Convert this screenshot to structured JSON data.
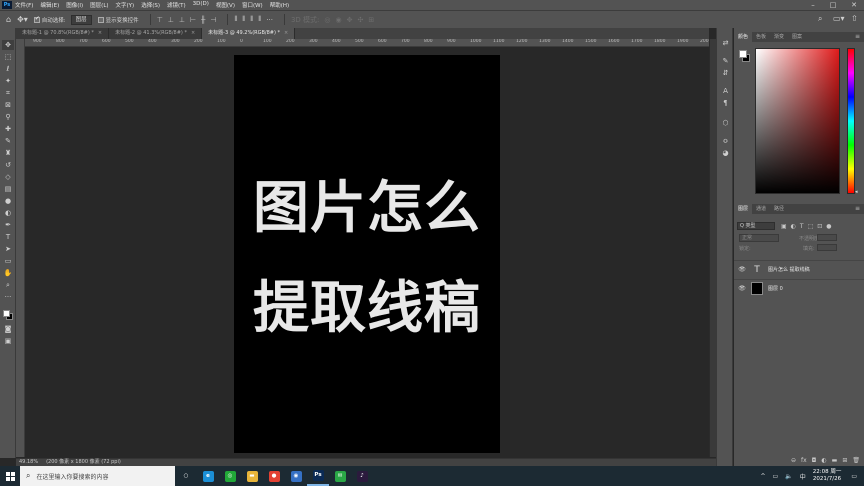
{
  "app": {
    "logo": "Ps",
    "menu": [
      "文件(F)",
      "编辑(E)",
      "图像(I)",
      "图层(L)",
      "文字(Y)",
      "选择(S)",
      "滤镜(T)",
      "3D(D)",
      "视图(V)",
      "窗口(W)",
      "帮助(H)"
    ],
    "window_controls": {
      "minimize": "–",
      "maximize": "□",
      "close": "✕"
    }
  },
  "options": {
    "auto_select_label": "自动选择:",
    "auto_select_checked": true,
    "target_value": "图层",
    "show_transform_label": "显示变换控件",
    "show_transform_checked": false
  },
  "tabs": [
    {
      "label": "未标题-1 @ 70.8%(RGB/8#) *",
      "close": "×",
      "active": false
    },
    {
      "label": "未标题-2 @ 41.3%(RGB/8#) *",
      "close": "×",
      "active": false
    },
    {
      "label": "未标题-3 @ 49.2%(RGB/8#) *",
      "close": "×",
      "active": true
    }
  ],
  "ruler_ticks": [
    "900",
    "800",
    "700",
    "600",
    "500",
    "400",
    "300",
    "200",
    "100",
    "0",
    "100",
    "200",
    "300",
    "400",
    "500",
    "600",
    "700",
    "800",
    "900",
    "1000",
    "1100",
    "1200",
    "1300",
    "1400",
    "1500",
    "1600",
    "1700",
    "1800",
    "1900",
    "2000"
  ],
  "canvas": {
    "background": "#000000",
    "text_color": "#e8e8e8",
    "line1": "图片怎么",
    "line2": "提取线稿"
  },
  "status": {
    "zoom": "49.18%",
    "doc_info": "(200 像素 x 1800 像素 (72 ppi)"
  },
  "color_panel": {
    "tabs": [
      "颜色",
      "色板",
      "渐变",
      "图案"
    ],
    "foreground": "#ffffff",
    "background": "#000000",
    "hue": "#e01b1b"
  },
  "layers_panel": {
    "tabs": [
      "图层",
      "通道",
      "路径"
    ],
    "filter_label": "Q 类型",
    "blend_mode": "正常",
    "opacity_label": "不透明度:",
    "lock_label": "锁定:",
    "fill_label": "填充:",
    "layers": [
      {
        "name": "图片怎么 提取线稿",
        "type": "text",
        "thumb": "T"
      },
      {
        "name": "图层 0",
        "type": "pixel",
        "thumb": ""
      }
    ]
  },
  "taskbar": {
    "search_placeholder": "在这里输入你要搜索的内容",
    "apps": [
      {
        "name": "task-view",
        "glyph": "○",
        "color": "transparent"
      },
      {
        "name": "edge",
        "glyph": "e",
        "color": "#1b8fd6"
      },
      {
        "name": "wechat-app",
        "glyph": "◎",
        "color": "#21a838"
      },
      {
        "name": "file-explorer",
        "glyph": "▬",
        "color": "#e8b53a"
      },
      {
        "name": "chrome",
        "glyph": "●",
        "color": "#e34133"
      },
      {
        "name": "app-circle",
        "glyph": "◉",
        "color": "#3570c4"
      },
      {
        "name": "photoshop",
        "glyph": "Ps",
        "color": "#0a2a55"
      },
      {
        "name": "wechat",
        "glyph": "✉",
        "color": "#2aa746"
      },
      {
        "name": "tiktok",
        "glyph": "♪",
        "color": "#2b1a3d"
      }
    ],
    "time": "22:08 周一",
    "date": "2021/7/26"
  }
}
